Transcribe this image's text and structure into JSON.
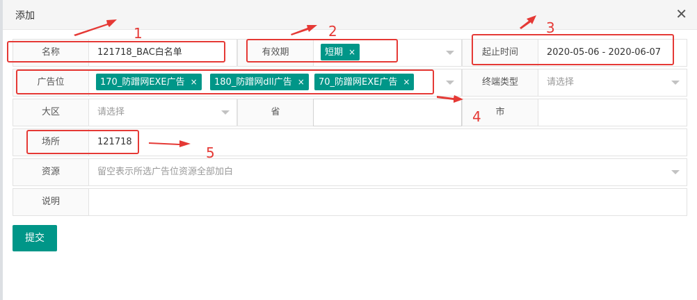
{
  "dialog": {
    "title": "添加",
    "close_glyph": "✕"
  },
  "form": {
    "name": {
      "label": "名称",
      "value": "121718_BAC白名单"
    },
    "validity": {
      "label": "有效期",
      "tag": "短期"
    },
    "period": {
      "label": "起止时间",
      "value": "2020-05-06 - 2020-06-07"
    },
    "ad_position": {
      "label": "广告位",
      "tags": [
        "170_防蹭网EXE广告",
        "180_防蹭网dll广告",
        "70_防蹭网EXE广告"
      ]
    },
    "terminal_type": {
      "label": "终端类型",
      "placeholder": "请选择"
    },
    "region": {
      "label": "大区",
      "placeholder": "请选择"
    },
    "province": {
      "label": "省",
      "value": ""
    },
    "city": {
      "label": "市",
      "value": ""
    },
    "venue": {
      "label": "场所",
      "value": "121718"
    },
    "resource": {
      "label": "资源",
      "placeholder": "留空表示所选广告位资源全部加白"
    },
    "description": {
      "label": "说明",
      "value": ""
    }
  },
  "submit_label": "提交",
  "tag_close_glyph": "×",
  "annotations": {
    "labels": [
      "1",
      "2",
      "3",
      "4",
      "5"
    ],
    "color": "#e53935"
  },
  "colors": {
    "accent": "#009688",
    "annotation": "#e53935"
  }
}
